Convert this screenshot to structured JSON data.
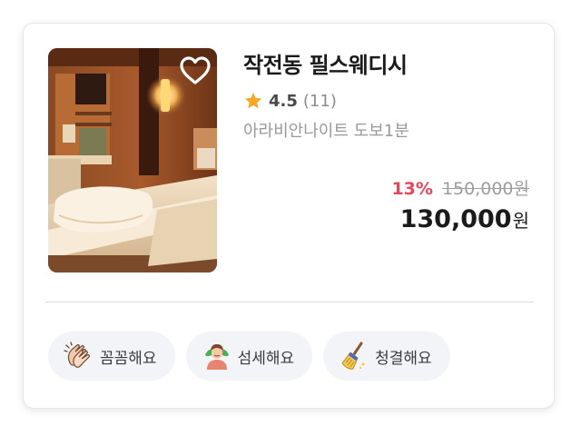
{
  "product": {
    "title": "작전동 필스웨디시",
    "rating": "4.5",
    "review_count": "(11)",
    "location": "아라비안나이트 도보1분",
    "discount_rate": "13%",
    "original_price": "150,000원",
    "final_price": "130,000",
    "final_unit": "원"
  },
  "tags": [
    {
      "label": "꼼꼼해요",
      "icon": "clapping-hands-icon"
    },
    {
      "label": "섬세해요",
      "icon": "massage-person-icon"
    },
    {
      "label": "청결해요",
      "icon": "broom-icon"
    }
  ],
  "colors": {
    "discount": "#e8455a",
    "star": "#f5a623",
    "tag_background": "#f2f4f7"
  }
}
